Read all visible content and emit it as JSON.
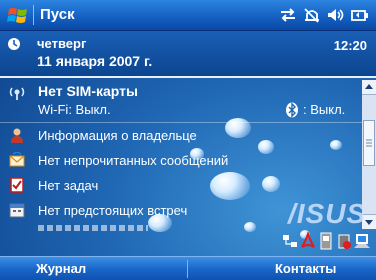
{
  "title_bar": {
    "title": "Пуск",
    "icons": [
      "connectivity-icon",
      "alarm-icon",
      "volume-icon",
      "battery-icon"
    ]
  },
  "today": {
    "weekday": "четверг",
    "date": "11 января 2007 г.",
    "time": "12:20"
  },
  "sim": {
    "title": "Нет SIM-карты",
    "wifi": "Wi-Fi: Выкл.",
    "bluetooth": ": Выкл."
  },
  "items": [
    {
      "label": "Информация о владельце",
      "icon": "owner-icon"
    },
    {
      "label": "Нет непрочитанных сообщений",
      "icon": "messages-icon"
    },
    {
      "label": "Нет задач",
      "icon": "tasks-icon"
    },
    {
      "label": "Нет предстоящих встреч",
      "icon": "calendar-icon"
    }
  ],
  "brand": "/ISUS",
  "softkeys": {
    "left": "Журнал",
    "right": "Контакты"
  },
  "colors": {
    "background": "#1f66b3",
    "title_bar": "#1561c4",
    "text": "#ffffff"
  }
}
